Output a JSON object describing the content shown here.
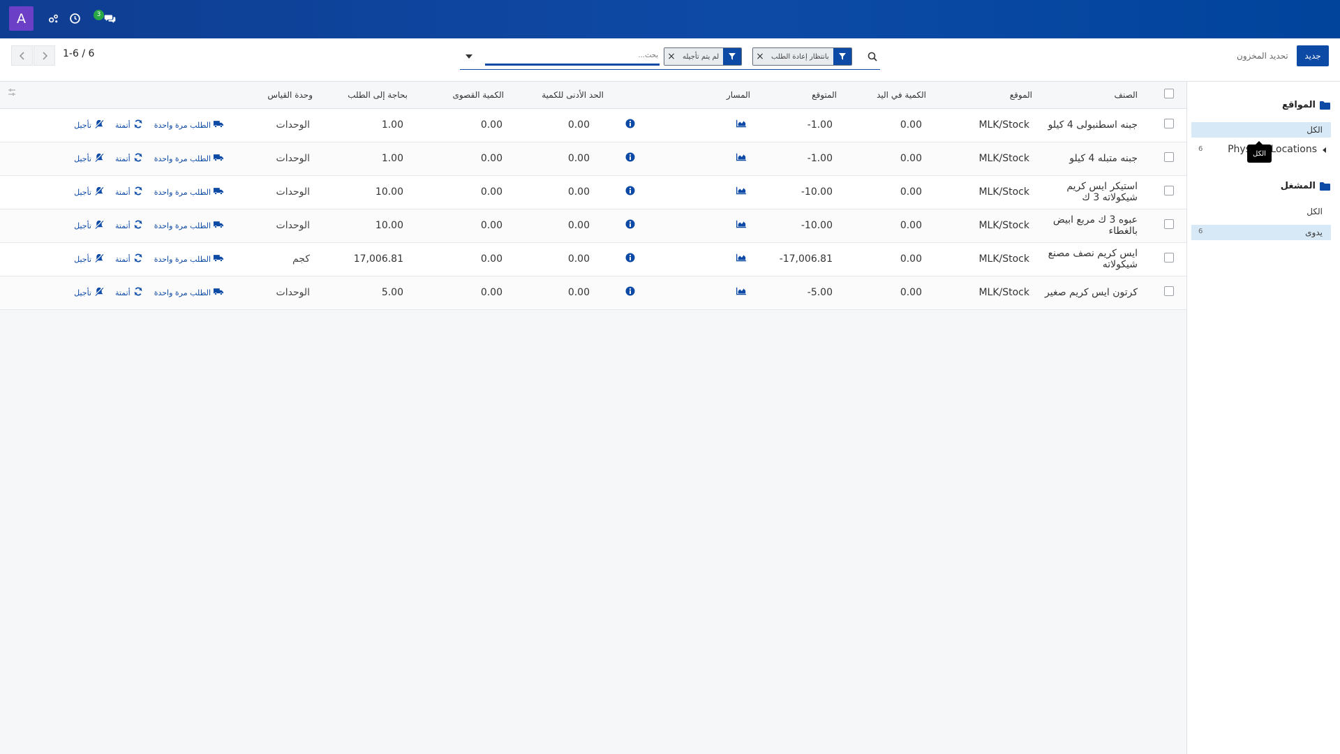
{
  "navbar": {
    "avatar_letter": "A",
    "icons": [
      "debug-icon",
      "activity-clock-icon",
      "messages-icon"
    ],
    "messages_count": "3"
  },
  "control_panel": {
    "create_label": "جديد",
    "update_label": "تحديد المخزون",
    "pager_value": "1-6 / 6",
    "search": {
      "placeholder": "بحث...",
      "facets": [
        {
          "label": "بانتظار إعادة الطلب"
        },
        {
          "label": "لم يتم تأجيله"
        }
      ]
    }
  },
  "list": {
    "columns": {
      "product": "الصنف",
      "location": "الموقع",
      "on_hand": "الكمية في اليد",
      "forecast": "المتوقع",
      "route": "المسار",
      "min_qty": "الحد الأدنى للكمية",
      "max_qty": "الكمية القصوى",
      "to_order": "بحاجة إلى الطلب",
      "uom": "وحدة القياس"
    },
    "actions": {
      "order_once": "الطلب مرة واحدة",
      "automate": "أتمتة",
      "snooze": "تأجيل"
    },
    "rows": [
      {
        "product": "جبنه اسطنبولى 4 كيلو",
        "location": "MLK/Stock",
        "on_hand": "0.00",
        "forecast": "-1.00",
        "min_qty": "0.00",
        "max_qty": "0.00",
        "to_order": "1.00",
        "uom": "الوحدات"
      },
      {
        "product": "جبنه متبله 4 كيلو",
        "location": "MLK/Stock",
        "on_hand": "0.00",
        "forecast": "-1.00",
        "min_qty": "0.00",
        "max_qty": "0.00",
        "to_order": "1.00",
        "uom": "الوحدات"
      },
      {
        "product": "استيكر ايس كريم شيكولاته 3 ك",
        "location": "MLK/Stock",
        "on_hand": "0.00",
        "forecast": "-10.00",
        "min_qty": "0.00",
        "max_qty": "0.00",
        "to_order": "10.00",
        "uom": "الوحدات"
      },
      {
        "product": "عبوه 3 ك مربع ابيض بالغطاء",
        "location": "MLK/Stock",
        "on_hand": "0.00",
        "forecast": "-10.00",
        "min_qty": "0.00",
        "max_qty": "0.00",
        "to_order": "10.00",
        "uom": "الوحدات"
      },
      {
        "product": "ايس كريم نصف مصنع شيكولاته",
        "location": "MLK/Stock",
        "on_hand": "0.00",
        "forecast": "-17,006.81",
        "min_qty": "0.00",
        "max_qty": "0.00",
        "to_order": "17,006.81",
        "uom": "كجم"
      },
      {
        "product": "كرتون ايس كريم صغير",
        "location": "MLK/Stock",
        "on_hand": "0.00",
        "forecast": "-5.00",
        "min_qty": "0.00",
        "max_qty": "0.00",
        "to_order": "5.00",
        "uom": "الوحدات"
      }
    ]
  },
  "sidebar": {
    "locations": {
      "header": "المواقع",
      "items": [
        {
          "label": "الكل",
          "count": ""
        },
        {
          "label": "Physical Locations",
          "count": "6"
        }
      ]
    },
    "trigger": {
      "header": "المشغل",
      "items": [
        {
          "label": "الكل",
          "count": ""
        },
        {
          "label": "يدوى",
          "count": "6"
        }
      ]
    },
    "tooltip": "الكل"
  }
}
